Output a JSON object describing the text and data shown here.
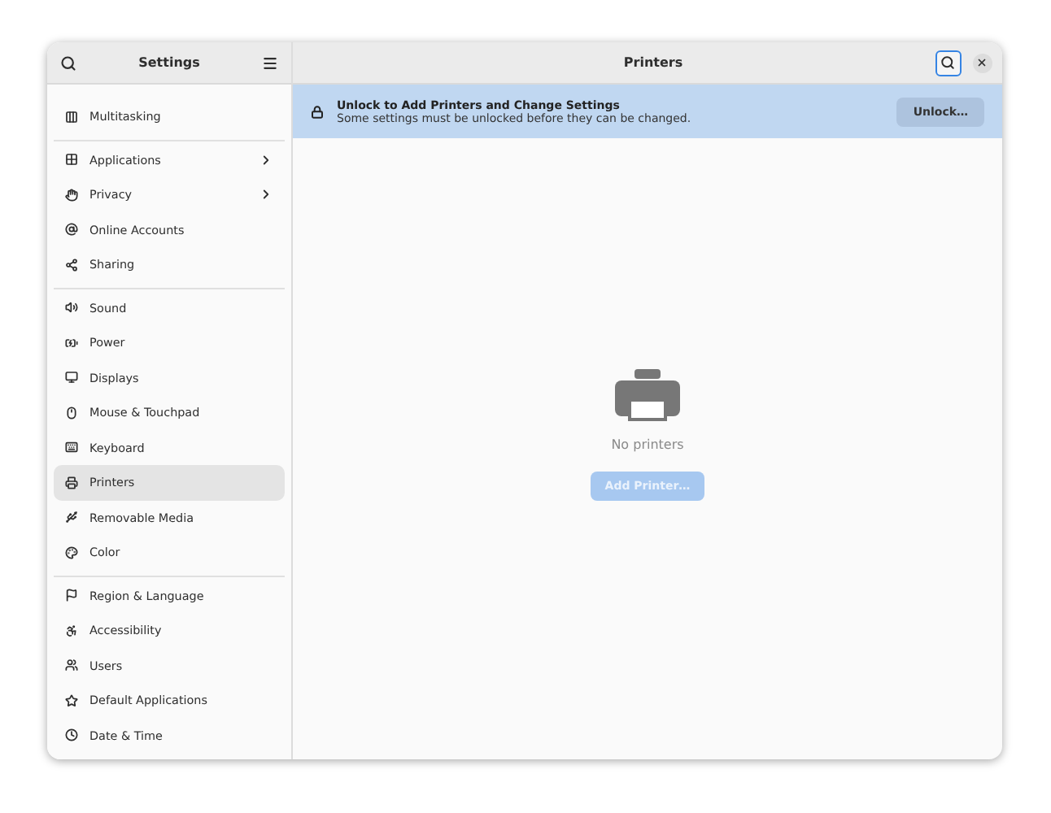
{
  "sidebar": {
    "title": "Settings",
    "sections": [
      {
        "items": [
          {
            "label": "Multitasking",
            "submenu": false,
            "selected": false
          }
        ]
      },
      {
        "items": [
          {
            "label": "Applications",
            "submenu": true,
            "selected": false
          },
          {
            "label": "Privacy",
            "submenu": true,
            "selected": false
          },
          {
            "label": "Online Accounts",
            "submenu": false,
            "selected": false
          },
          {
            "label": "Sharing",
            "submenu": false,
            "selected": false
          }
        ]
      },
      {
        "items": [
          {
            "label": "Sound",
            "submenu": false,
            "selected": false
          },
          {
            "label": "Power",
            "submenu": false,
            "selected": false
          },
          {
            "label": "Displays",
            "submenu": false,
            "selected": false
          },
          {
            "label": "Mouse & Touchpad",
            "submenu": false,
            "selected": false
          },
          {
            "label": "Keyboard",
            "submenu": false,
            "selected": false
          },
          {
            "label": "Printers",
            "submenu": false,
            "selected": true
          },
          {
            "label": "Removable Media",
            "submenu": false,
            "selected": false
          },
          {
            "label": "Color",
            "submenu": false,
            "selected": false
          }
        ]
      },
      {
        "items": [
          {
            "label": "Region & Language",
            "submenu": false,
            "selected": false
          },
          {
            "label": "Accessibility",
            "submenu": false,
            "selected": false
          },
          {
            "label": "Users",
            "submenu": false,
            "selected": false
          },
          {
            "label": "Default Applications",
            "submenu": false,
            "selected": false
          },
          {
            "label": "Date & Time",
            "submenu": false,
            "selected": false
          }
        ]
      }
    ]
  },
  "main": {
    "title": "Printers",
    "banner": {
      "title": "Unlock to Add Printers and Change Settings",
      "text": "Some settings must be unlocked before they can be changed.",
      "button": "Unlock…"
    },
    "empty": {
      "text": "No printers",
      "button": "Add Printer…",
      "button_disabled": true
    }
  }
}
